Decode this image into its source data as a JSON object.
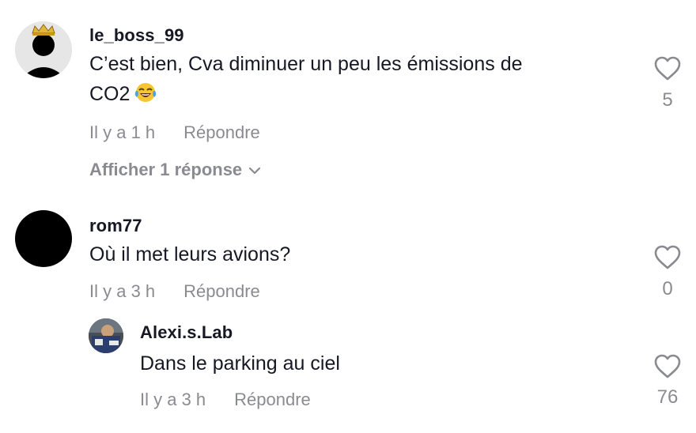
{
  "comments": [
    {
      "username": "le_boss_99",
      "text": "C’est bien, Cva diminuer un peu les émissions de CO2",
      "text_line1": "C’est bien, Cva diminuer un peu les émissions de",
      "text_line2": "CO2",
      "emoji": "face-with-tears-of-joy",
      "time": "Il y a 1 h",
      "reply_label": "Répondre",
      "likes": "5",
      "view_replies": "Afficher 1 réponse"
    },
    {
      "username": "rom77",
      "text": "Où il met leurs avions?",
      "time": "Il y a 3 h",
      "reply_label": "Répondre",
      "likes": "0"
    }
  ],
  "reply": {
    "username": "Alexi.s.Lab",
    "text": "Dans le parking au ciel",
    "time": "Il y a 3 h",
    "reply_label": "Répondre",
    "likes": "76"
  },
  "colors": {
    "primary_text": "#161823",
    "secondary_text": "#8a8b91",
    "avatar_black": "#000000"
  },
  "icons": {
    "like": "heart-outline-icon",
    "expand": "chevron-down-icon",
    "crown": "crown-icon"
  }
}
